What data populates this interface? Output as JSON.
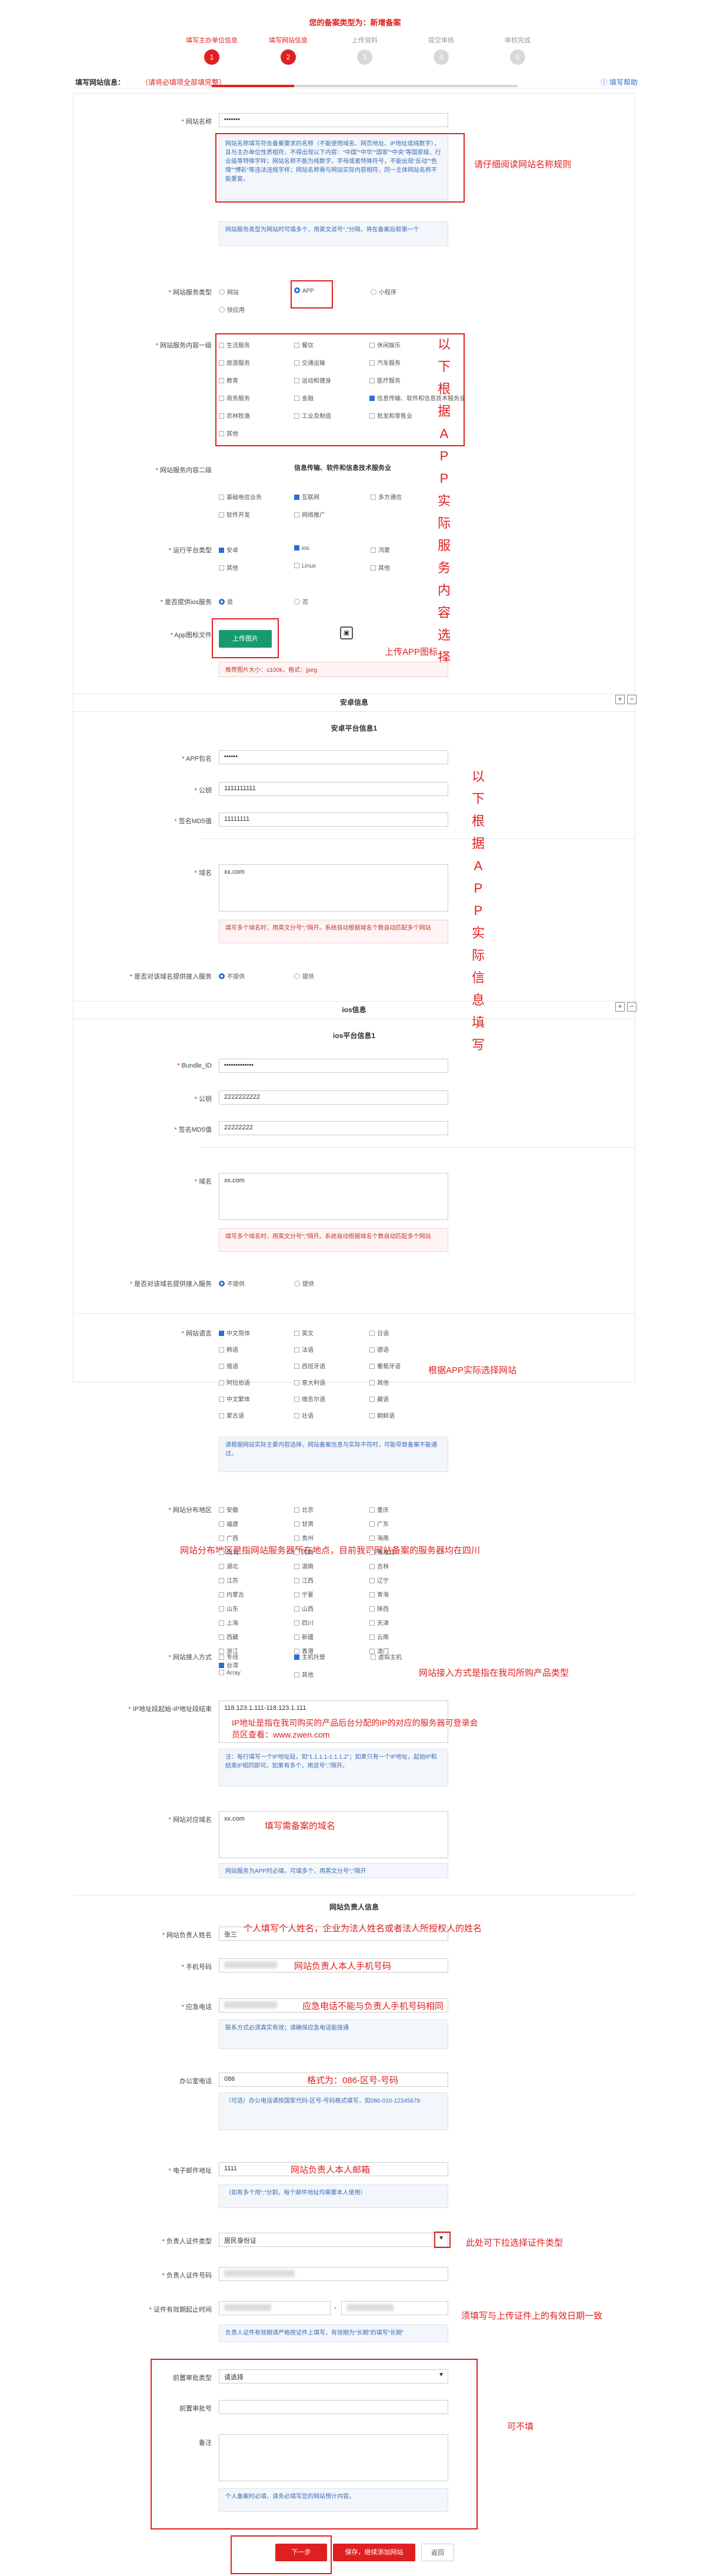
{
  "page_title": "您的备案类型为：新增备案",
  "steps": [
    {
      "num": "1",
      "label": "填写主办单位信息"
    },
    {
      "num": "2",
      "label": "填写网站信息"
    },
    {
      "num": "3",
      "label": "上传资料"
    },
    {
      "num": "4",
      "label": "提交审核"
    },
    {
      "num": "5",
      "label": "审核完成"
    }
  ],
  "section": {
    "title": "填写网站信息：",
    "required_note": "（请将必填项全部填完整）",
    "help": "填写帮助"
  },
  "site": {
    "name_label": "网站名称",
    "name_value": "•••••••",
    "name_rules": "网站名称填写符合备案要求的名称（不能使用域名、网页地址、IP地址或纯数字），且与主办单位性质相符，不得出现以下内容：“中国”“中华”“国家”“中央”等国家级、行业级等特殊字样；网站名称不能为纯数字、字母或者特殊符号，不能出现“反动”“色情”“博彩”等违法违规字样；网站名称需与网站实际内容相符，同一主体网站名称不能重复。",
    "name_note": "网站服务类型为网站时可填多个，用英文逗号“,”分隔，将在备案后取第一个",
    "service_type_label": "网站服务类型",
    "service_types": [
      "网站",
      "APP",
      "小程序",
      "快应用"
    ],
    "content_label": "网站服务内容一级",
    "content_items": [
      "生活服务",
      "餐饮",
      "休闲娱乐",
      "旅游服务",
      "交通运输",
      "汽车服务",
      "教育",
      "运动和健身",
      "医疗服务",
      "商务服务",
      "金融",
      "信息传输、软件和信息技术服务业",
      "农林牧渔",
      "工业及制造",
      "批发和零售业",
      "其他"
    ],
    "category_label": "网站服务内容二级",
    "category_title": "信息传输、软件和信息技术服务业",
    "category_items": [
      "基础电信业务",
      "互联网",
      "多方通信",
      "软件开发",
      "网络推广"
    ],
    "platform_label": "运行平台类型",
    "platforms": [
      "安卓",
      "ios",
      "鸿蒙",
      "其他",
      "Linux",
      "其他"
    ],
    "access_label": "是否提供ios服务",
    "yes": "是",
    "no": "否",
    "icon_label": "App图标文件",
    "upload_btn": "上传图片",
    "icon_note": "推荐图片大小：≤100k，格式：jpeg"
  },
  "android": {
    "header": "安卓信息",
    "sub": "安卓平台信息1",
    "appid_label": "APP包名",
    "appid_value": "••••••",
    "pubkey_label": "公钥",
    "pubkey_value": "1111111111",
    "md5_label": "签名MD5值",
    "md5_value": "11111111",
    "domain_label": "域名",
    "domain_value": "xx.com",
    "domain_note": "填写多个域名时，用英文分号“;”隔开。系统自动根据域名个数自动匹配多个网站",
    "fw_label": "是否对该域名提供接入服务",
    "fw_yes": "不提供",
    "fw_no": "提供"
  },
  "ios": {
    "header": "ios信息",
    "sub": "ios平台信息1",
    "bundle_label": "Bundle_ID",
    "bundle_value": "•••••••••••••",
    "pubkey_label": "公钥",
    "pubkey_value": "2222222222",
    "md5_label": "签名MD5值",
    "md5_value": "22222222",
    "domain_label": "域名",
    "domain_value": "xx.com",
    "domain_note": "填写多个域名时，用英文分号“;”隔开。系统自动根据域名个数自动匹配多个网站",
    "fw_label": "是否对该域名提供接入服务",
    "fw_yes": "不提供",
    "fw_no": "提供"
  },
  "lang": {
    "label": "网站语言",
    "items": [
      "中文简体",
      "英文",
      "日语",
      "韩语",
      "法语",
      "德语",
      "俄语",
      "西班牙语",
      "葡萄牙语",
      "阿拉伯语",
      "意大利语",
      "其他",
      "中文繁体",
      "维吾尔语",
      "藏语",
      "蒙古语",
      "壮语",
      "朝鲜语"
    ],
    "note": "请根据网站实际主要内容选择，网站备案信息与实际不符时，可能导致备案不能通过。"
  },
  "region": {
    "label": "网站分布地区",
    "items": [
      "安徽",
      "北京",
      "重庆",
      "福建",
      "甘肃",
      "广东",
      "广西",
      "贵州",
      "海南",
      "河北",
      "河南",
      "黑龙江",
      "湖北",
      "湖南",
      "吉林",
      "江苏",
      "江西",
      "辽宁",
      "内蒙古",
      "宁夏",
      "青海",
      "山东",
      "山西",
      "陕西",
      "上海",
      "四川",
      "天津",
      "西藏",
      "新疆",
      "云南",
      "浙江",
      "香港",
      "澳门",
      "台湾"
    ]
  },
  "access": {
    "label": "网站接入方式",
    "items": [
      "专线",
      "主机托管",
      "虚拟主机",
      "Array",
      "其他"
    ]
  },
  "ip": {
    "label": "IP地址段起始-IP地址段结束",
    "value": "118.123.1.111-118.123.1.111",
    "note": "注：每行填写一个IP地址段，如“1.1.1.1-1.1.1.2”；如果只有一个IP地址，起始IP和结束IP相同即可。如果有多个，用逗号“,”隔开。"
  },
  "domain": {
    "label": "网站对应域名",
    "value": "xx.com",
    "note": "网站服务为APP时必填，可填多个，用英文分号“;”隔开"
  },
  "owner": {
    "header": "网站负责人信息",
    "name_label": "网站负责人姓名",
    "name_value": "张三",
    "mobile_label": "手机号码",
    "phone_label": "应急电话",
    "phone_note": "联系方式必须真实有效；请确保应急电话能接通",
    "office_label": "办公室电话",
    "office_value": "086",
    "office_note": "（可选）办公电话请按国家代码-区号-号码格式填写，如086-010-12345678",
    "email_label": "电子邮件地址",
    "email_value": "1111",
    "email_note": "（如有多个用“;”分割，每个邮件地址均需要本人使用）",
    "idtype_label": "负责人证件类型",
    "idtype_value": "居民身份证",
    "idnum_label": "负责人证件号码",
    "valid_label": "证件有效期起止时间",
    "valid_note": "负责人证件有效期请严格按证件上填写，有效期为“长期”的填写“长期”",
    "remark_box": {
      "type_label": "前置审批类型",
      "type_value": "请选择",
      "num_label": "前置审批号",
      "remark_label": "备注",
      "note": "个人备案时必填，请务必填写您的网站预计内容。"
    }
  },
  "buttons": {
    "prev": "下一步",
    "save": "保存，继续添加网站",
    "cancel": "返回"
  },
  "annotations": {
    "name_rule": "请仔细阅读网站名称规则",
    "content_v": "以下根据APP实际服务内容选择",
    "upload_icon": "上传APP图标",
    "fill_v": "以下根据APP实际信息填写",
    "lang": "根据APP实际选择网站",
    "region": "网站分布地区是指网站服务器所在地点，目前我司网站备案的服务器均在四川",
    "access": "网站接入方式是指在我司所购产品类型",
    "ip": "IP地址是指在我司购买的产品后台分配的IP的对应的服务器可登录会员区查看：www.zwen.com",
    "domain": "填写需备案的域名",
    "owner_name": "个人填写个人姓名，企业为法人姓名或者法人所授权人的姓名",
    "mobile": "网站负责人本人手机号码",
    "emerg": "应急电话不能与负责人手机号码相同",
    "office": "格式为：086-区号-号码",
    "email": "网站负责人本人邮箱",
    "idtype": "此处可下拉选择证件类型",
    "valid": "须填写与上传证件上的有效日期一致",
    "optional": "可不填"
  },
  "colors": {
    "accent": "#e02020",
    "link": "#2a6ed3",
    "note_bg": "#f3f6fb"
  }
}
